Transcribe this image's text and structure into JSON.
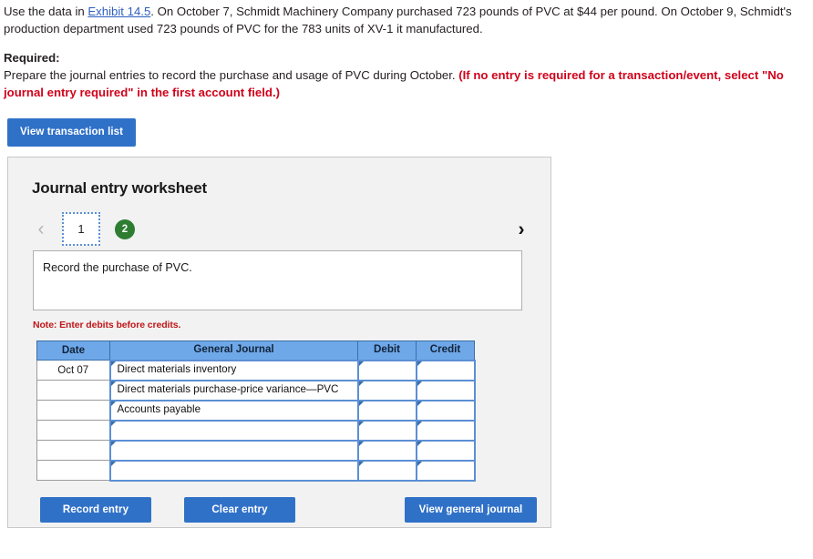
{
  "problem": {
    "line1_pre": "Use the data in ",
    "exhibit_link": "Exhibit 14.5",
    "line1_post": ". On October 7, Schmidt Machinery Company purchased 723 pounds of PVC at $44 per pound. On October 9, Schmidt's production department used 723 pounds of PVC for the 783 units of XV-1 it manufactured.",
    "required_label": "Required:",
    "required_text": "Prepare the journal entries to record the purchase and usage of PVC during October. ",
    "required_note": "(If no entry is required for a transaction/event, select \"No journal entry required\" in the first account field.)"
  },
  "toolbar": {
    "view_transaction_list": "View transaction list"
  },
  "worksheet": {
    "title": "Journal entry worksheet",
    "pager": {
      "prev_icon": "‹",
      "next_icon": "›",
      "tabs": [
        {
          "label": "1",
          "state": "selected"
        },
        {
          "label": "2",
          "state": "complete"
        }
      ]
    },
    "description": "Record the purchase of PVC.",
    "note": "Note: Enter debits before credits.",
    "table": {
      "headers": [
        "Date",
        "General Journal",
        "Debit",
        "Credit"
      ],
      "rows": [
        {
          "date": "Oct 07",
          "account": "Direct materials inventory",
          "debit": "",
          "credit": ""
        },
        {
          "date": "",
          "account": "Direct materials purchase-price variance—PVC",
          "debit": "",
          "credit": ""
        },
        {
          "date": "",
          "account": "Accounts payable",
          "debit": "",
          "credit": ""
        },
        {
          "date": "",
          "account": "",
          "debit": "",
          "credit": ""
        },
        {
          "date": "",
          "account": "",
          "debit": "",
          "credit": ""
        },
        {
          "date": "",
          "account": "",
          "debit": "",
          "credit": ""
        }
      ]
    },
    "actions": {
      "record_entry": "Record entry",
      "clear_entry": "Clear entry",
      "view_general_journal": "View general journal"
    }
  },
  "colors": {
    "button_blue": "#3071c8",
    "header_blue": "#6fa8e8",
    "cell_border_blue": "#5b8fd4",
    "green_badge": "#2e7d32",
    "red_note": "#c0171a",
    "red_bold": "#d0021b",
    "link_blue": "#2f5fbf"
  }
}
